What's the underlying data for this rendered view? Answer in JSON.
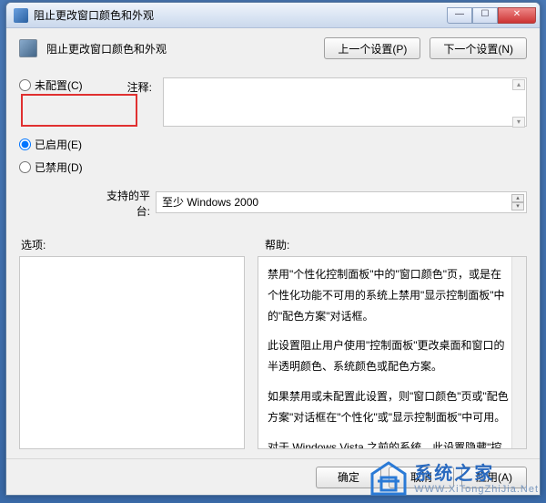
{
  "window": {
    "title": "阻止更改窗口颜色和外观"
  },
  "header": {
    "title": "阻止更改窗口颜色和外观",
    "prev_btn": "上一个设置(P)",
    "next_btn": "下一个设置(N)"
  },
  "radios": {
    "not_configured": "未配置(C)",
    "enabled": "已启用(E)",
    "disabled": "已禁用(D)",
    "selected": "enabled"
  },
  "labels": {
    "comment": "注释:",
    "platform": "支持的平台:",
    "options": "选项:",
    "help": "帮助:"
  },
  "fields": {
    "comment_value": "",
    "platform_value": "至少 Windows 2000"
  },
  "help_text": {
    "p1": "禁用\"个性化控制面板\"中的\"窗口颜色\"页，或是在个性化功能不可用的系统上禁用\"显示控制面板\"中的\"配色方案\"对话框。",
    "p2": "此设置阻止用户使用\"控制面板\"更改桌面和窗口的半透明颜色、系统颜色或配色方案。",
    "p3": "如果禁用或未配置此设置，则\"窗口颜色\"页或\"配色方案\"对话框在\"个性化\"或\"显示控制面板\"中可用。",
    "p4": "对于 Windows Vista 之前的系统，此设置隐藏\"控制面板\"中的\"显示\"中的\"外观\"和\"主题\"选项卡。"
  },
  "footer": {
    "ok": "确定",
    "cancel": "取消",
    "apply": "应用(A)"
  },
  "watermark": {
    "cn": "系统之家",
    "url": "WWW.XiTongZhiJia.Net"
  }
}
